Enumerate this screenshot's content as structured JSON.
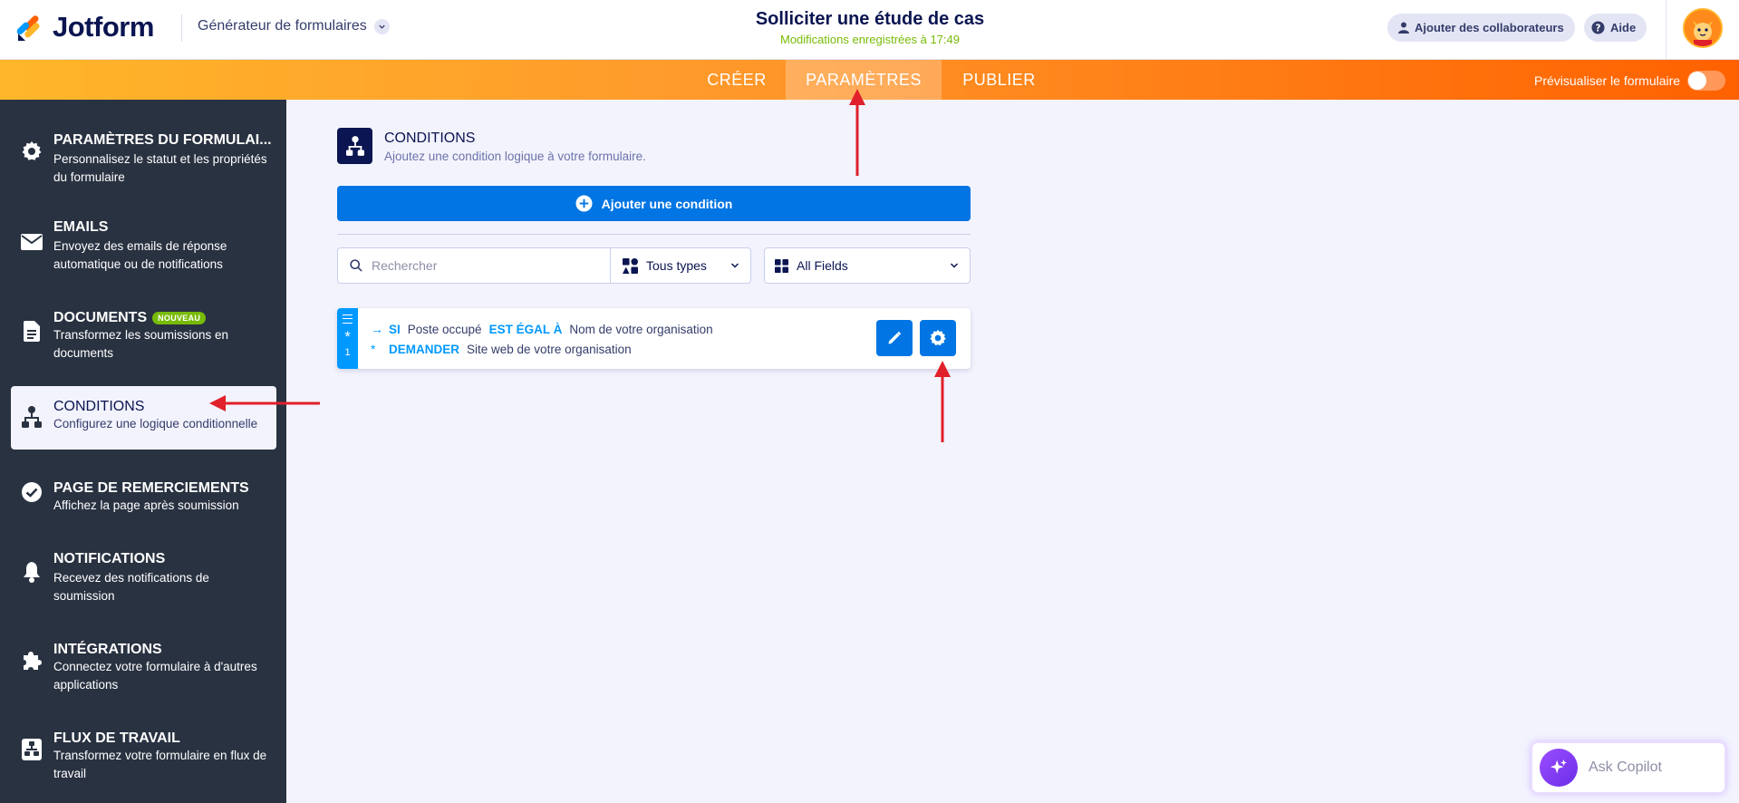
{
  "header": {
    "logo_text": "Jotform",
    "builder_label": "Générateur de formulaires",
    "form_title": "Solliciter une étude de cas",
    "save_status": "Modifications enregistrées à 17:49",
    "collaborators_label": "Ajouter des collaborateurs",
    "help_label": "Aide"
  },
  "nav": {
    "tabs": [
      {
        "label": "CRÉER"
      },
      {
        "label": "PARAMÈTRES",
        "active": true
      },
      {
        "label": "PUBLIER"
      }
    ],
    "preview_label": "Prévisualiser le formulaire",
    "preview_on": false
  },
  "sidebar": {
    "items": [
      {
        "title": "PARAMÈTRES DU FORMULAI...",
        "desc": "Personnalisez le statut et les propriétés du formulaire",
        "icon": "gear-icon"
      },
      {
        "title": "EMAILS",
        "desc": "Envoyez des emails de réponse automatique ou de notifications",
        "icon": "envelope-icon"
      },
      {
        "title": "DOCUMENTS",
        "badge": "NOUVEAU",
        "desc": "Transformez les soumissions en documents",
        "icon": "document-icon"
      },
      {
        "title": "CONDITIONS",
        "desc": "Configurez une logique conditionnelle",
        "icon": "sitemap-icon",
        "active": true
      },
      {
        "title": "PAGE DE REMERCIEMENTS",
        "desc": "Affichez la page après soumission",
        "icon": "check-circle-icon"
      },
      {
        "title": "NOTIFICATIONS",
        "desc": "Recevez des notifications de soumission",
        "icon": "bell-icon"
      },
      {
        "title": "INTÉGRATIONS",
        "desc": "Connectez votre formulaire à d'autres applications",
        "icon": "puzzle-icon"
      },
      {
        "title": "FLUX DE TRAVAIL",
        "desc": "Transformez votre formulaire en flux de travail",
        "icon": "workflow-icon"
      }
    ]
  },
  "main": {
    "section_title": "CONDITIONS",
    "section_subtitle": "Ajoutez une condition logique à votre formulaire.",
    "add_condition_label": "Ajouter une condition",
    "search_placeholder": "Rechercher",
    "type_filter": "Tous types",
    "field_filter": "All Fields",
    "conditions": [
      {
        "number": "1",
        "if_keyword": "SI",
        "if_field": "Poste occupé",
        "operator": "EST ÉGAL À",
        "value": "Nom de votre organisation",
        "action_keyword": "DEMANDER",
        "action_field": "Site web de votre organisation"
      }
    ]
  },
  "copilot": {
    "label": "Ask Copilot"
  },
  "colors": {
    "brand_orange": "#ff6100",
    "accent_blue": "#0075e3",
    "sidebar_bg": "#293241",
    "annotation_red": "#e0202a"
  }
}
